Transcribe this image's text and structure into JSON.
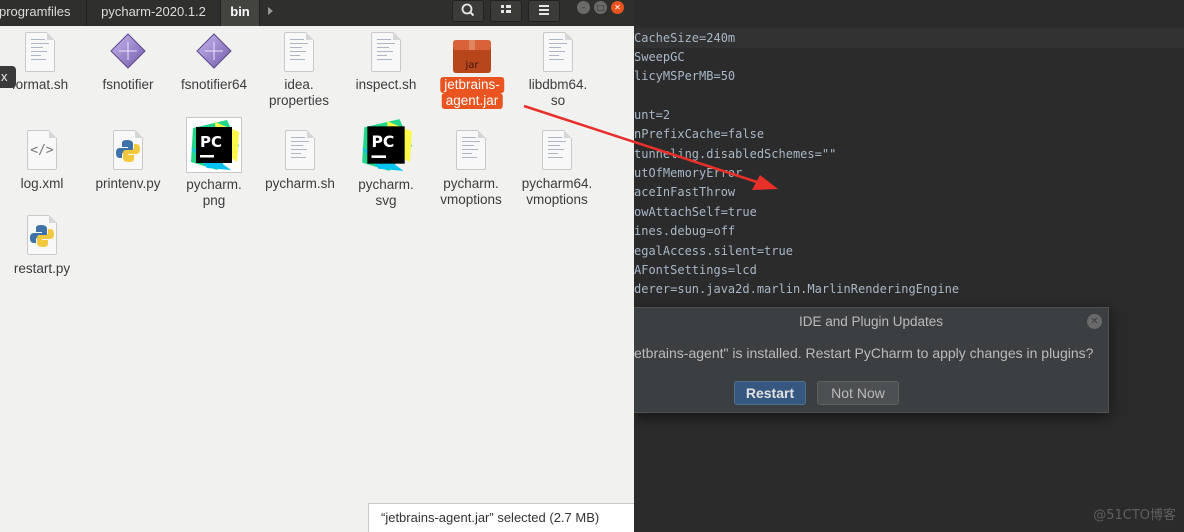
{
  "file_manager": {
    "breadcrumbs": [
      "programfiles",
      "pycharm-2020.1.2",
      "bin"
    ],
    "toolbar_icons": [
      "search-icon",
      "view-list-icon",
      "menu-icon"
    ],
    "window_controls": [
      "minimize-icon",
      "maximize-icon",
      "close-icon"
    ],
    "side_tab": "x",
    "files": [
      {
        "line1": "format.sh",
        "line2": "",
        "icon": "text-doc"
      },
      {
        "line1": "fsnotifier",
        "line2": "",
        "icon": "executable"
      },
      {
        "line1": "fsnotifier64",
        "line2": "",
        "icon": "executable"
      },
      {
        "line1": "idea.",
        "line2": "properties",
        "icon": "text-doc"
      },
      {
        "line1": "inspect.sh",
        "line2": "",
        "icon": "text-doc"
      },
      {
        "line1": "jetbrains-",
        "line2": "agent.jar",
        "icon": "jar",
        "jar_label": "jar",
        "selected": true
      },
      {
        "line1": "libdbm64.",
        "line2": "so",
        "icon": "text-doc"
      },
      {
        "line1": "log.xml",
        "line2": "",
        "icon": "xml"
      },
      {
        "line1": "printenv.py",
        "line2": "",
        "icon": "python"
      },
      {
        "line1": "pycharm.",
        "line2": "png",
        "icon": "pycharm",
        "icon_text": "PC"
      },
      {
        "line1": "pycharm.sh",
        "line2": "",
        "icon": "text-doc"
      },
      {
        "line1": "pycharm.",
        "line2": "svg",
        "icon": "pycharm",
        "icon_text": "PC"
      },
      {
        "line1": "pycharm.",
        "line2": "vmoptions",
        "icon": "text-doc"
      },
      {
        "line1": "pycharm64.",
        "line2": "vmoptions",
        "icon": "text-doc"
      },
      {
        "line1": "restart.py",
        "line2": "",
        "icon": "python"
      }
    ],
    "status": "“jetbrains-agent.jar” selected  (2.7 MB)"
  },
  "editor": {
    "lines": [
      "CacheSize=240m",
      "SweepGC",
      "licyMSPerMB=50",
      "",
      "unt=2",
      "nPrefixCache=false",
      "tunneling.disabledSchemes=\"\"",
      "utOfMemoryError",
      "aceInFastThrow",
      "owAttachSelf=true",
      "ines.debug=off",
      "egalAccess.silent=true",
      "AFontSettings=lcd",
      "derer=sun.java2d.marlin.MarlinRenderingEngine"
    ]
  },
  "dialog": {
    "title": "IDE and Plugin Updates",
    "message": "etbrains-agent\" is installed. Restart PyCharm to apply changes in plugins?",
    "restart_label": "Restart",
    "not_now_label": "Not Now"
  },
  "watermark": "@51CTO博客",
  "colors": {
    "selection": "#e95420",
    "arrow": "#e8302a",
    "dialog_bg": "#3c3f41",
    "editor_bg": "#2b2b2b",
    "primary_button": "#365880"
  }
}
